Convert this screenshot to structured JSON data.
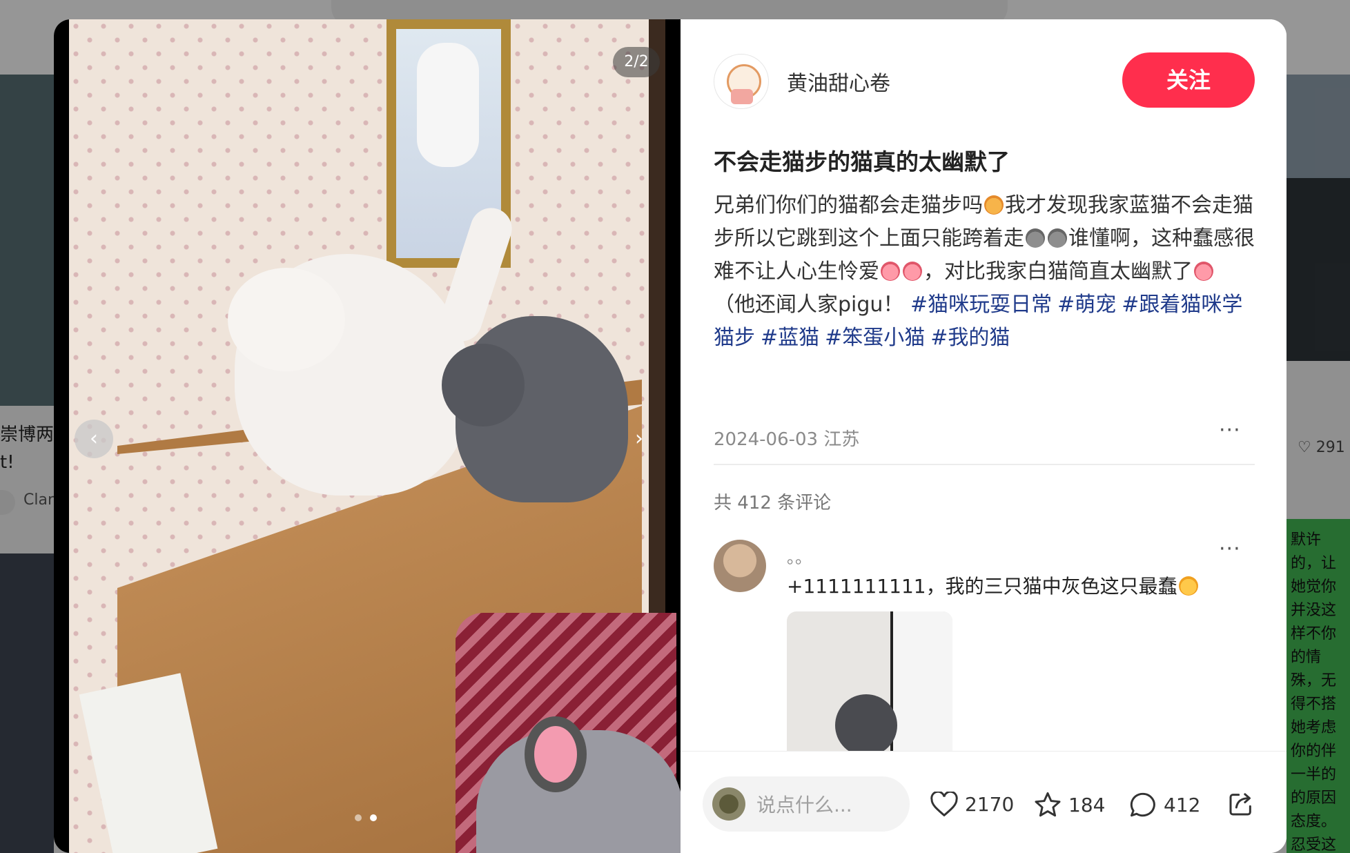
{
  "background": {
    "left_card_text_line1": "崇博两周",
    "left_card_text_line2": "t!",
    "left_card_author": "Clar",
    "right_card_likes": "291",
    "right_card_text": "默许的，让她觉你并没这样不你的情殊，无得不搭她考虑你的伴一半的的原因态度。忍受这期为了"
  },
  "media": {
    "counter": "2/2",
    "prev_icon": "chevron-left-icon",
    "next_icon": "chevron-right-icon",
    "total_slides": 2,
    "active_slide": 2
  },
  "author": {
    "name": "黄油甜心卷",
    "follow_label": "关注"
  },
  "post": {
    "title": "不会走猫步的猫真的太幽默了",
    "desc_part1": "兄弟们你们的猫都会走猫步吗",
    "desc_part2": "我才发现我家蓝猫不会走猫步所以它跳到这个上面只能跨着走",
    "desc_part3": "谁懂啊，这种蠢感很难不让人心生怜爱",
    "desc_part4": "，对比我家白猫简直太幽默了",
    "desc_part5": "（他还闻人家pigu！",
    "tags": [
      "#猫咪玩耍日常",
      "#萌宠",
      "#跟着猫咪学猫步",
      "#蓝猫",
      "#笨蛋小猫",
      "#我的猫"
    ],
    "date_location": "2024-06-03 江苏"
  },
  "comments": {
    "count_label": "共 412 条评论",
    "items": [
      {
        "name": "。。",
        "text": "+1111111111，我的三只猫中灰色这只最蠢"
      }
    ]
  },
  "bottom_bar": {
    "input_placeholder": "说点什么...",
    "likes": "2170",
    "favorites": "184",
    "comments": "412"
  },
  "colors": {
    "accent": "#ff2e4d",
    "tag": "#1f3a8a"
  }
}
